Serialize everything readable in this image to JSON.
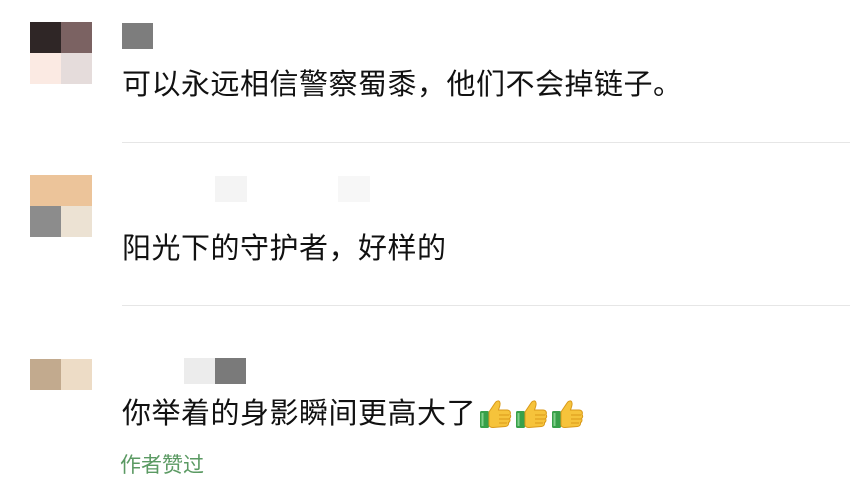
{
  "comments": [
    {
      "text": "可以永远相信警察蜀黍，他们不会掉链子。",
      "avatar_colors": [
        "#2f2626",
        "#7b6262",
        "#fbeae3",
        "#e5dcdb"
      ],
      "name_blur_colors": [
        "#7d7d7d"
      ]
    },
    {
      "text": "阳光下的守护者，好样的",
      "avatar_colors": [
        "#ecc49a",
        "#ecc49a",
        "#8c8c8c",
        "#ece2d3"
      ],
      "name_blur_colors": [
        "#f4f4f4",
        "#f7f7f7"
      ]
    },
    {
      "text": "你举着的身影瞬间更高大了",
      "emoji_icons": [
        "thumbs-up-icon",
        "thumbs-up-icon",
        "thumbs-up-icon"
      ],
      "avatar_colors": [
        "#c2aa8e",
        "#eddcc6",
        "#ffffff",
        "#ffffff"
      ],
      "name_blur_colors": [
        "#ececec",
        "#7a7a7a"
      ],
      "author_liked": "作者赞过"
    }
  ],
  "colors": {
    "text": "#111111",
    "author_liked": "#5b9a63",
    "divider": "#e6e6e6",
    "thumb_yellow": "#f6c33b",
    "thumb_cuff": "#38a04a"
  }
}
